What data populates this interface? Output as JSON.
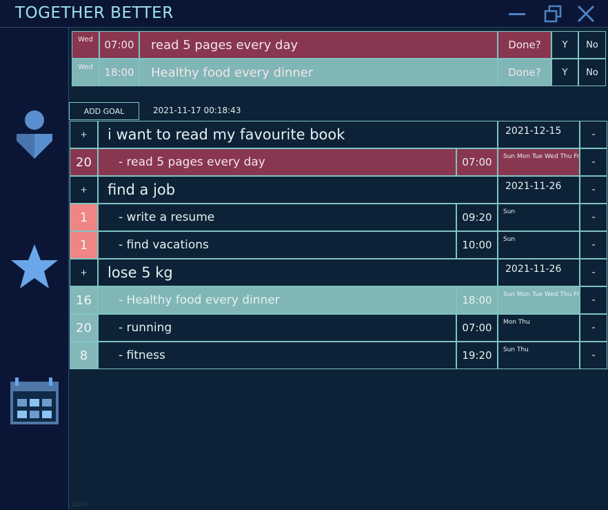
{
  "app_title": "TOGETHER BETTER",
  "colors": {
    "red": "#893650",
    "teal": "#80b6b6",
    "dark": "#0d2236",
    "salmon": "#ef8585",
    "border": "#7fc4c4"
  },
  "today": [
    {
      "day": "Wed",
      "time": "07:00",
      "task": "read 5 pages every day",
      "done": "Done?",
      "yes": "Y",
      "no": "No"
    },
    {
      "day": "Wed",
      "time": "18:00",
      "task": "Healthy food every dinner",
      "done": "Done?",
      "yes": "Y",
      "no": "No"
    }
  ],
  "add_goal_label": "ADD GOAL",
  "timestamp": "2021-11-17 00:18:43",
  "goal_rows": [
    {
      "type": "goal",
      "plus": "+",
      "text": "i want to read my favourite book",
      "date": "2021-12-15",
      "minus": "-"
    },
    {
      "type": "task",
      "count": "20",
      "text": "- read 5 pages every day",
      "time": "07:00",
      "days": "Sun Mon Tue Wed Thu Fri",
      "minus": "-"
    },
    {
      "type": "goal",
      "plus": "+",
      "text": "find a job",
      "date": "2021-11-26",
      "minus": "-"
    },
    {
      "type": "task",
      "count": "1",
      "text": "- write a resume",
      "time": "09:20",
      "days": "Sun",
      "minus": "-"
    },
    {
      "type": "task",
      "count": "1",
      "text": "- find vacations",
      "time": "10:00",
      "days": "Sun",
      "minus": "-"
    },
    {
      "type": "goal",
      "plus": "+",
      "text": "lose 5 kg",
      "date": "2021-11-26",
      "minus": "-"
    },
    {
      "type": "task",
      "count": "16",
      "text": "- Healthy food every dinner",
      "time": "18:00",
      "days": "Sun Mon Tue Wed Thu Fri",
      "minus": "-"
    },
    {
      "type": "task",
      "count": "20",
      "text": "- running",
      "time": "07:00",
      "days": "Mon Thu",
      "minus": "-"
    },
    {
      "type": "task",
      "count": "8",
      "text": "- fitness",
      "time": "19:20",
      "days": "Sun Thu",
      "minus": "-"
    }
  ],
  "footer_label": "abel",
  "sidebar_icons": [
    "user-icon",
    "star-icon",
    "calendar-icon"
  ]
}
